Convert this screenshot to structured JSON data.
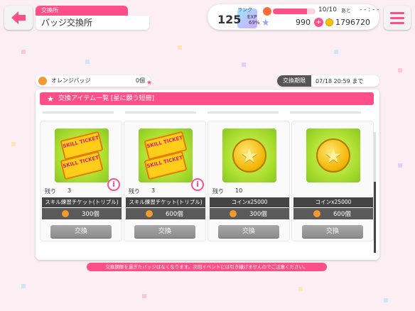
{
  "header": {
    "subtitle": "交換所",
    "title": "バッジ交換所"
  },
  "status": {
    "rank_label": "ランク",
    "rank": "125",
    "exp_label": "EXP",
    "exp_percent": "69%",
    "life": "10/10",
    "life_after": "あと",
    "life_time": "- - : - -",
    "life_fill": 0.8,
    "gems": "990",
    "coins": "1796720"
  },
  "badge": {
    "name": "オレンジバッジ",
    "count": "0個"
  },
  "deadline": {
    "label": "交換期限",
    "value": "07/18 20:59 まで"
  },
  "panel": {
    "title": "交換アイテム一覧 [星に願う短冊]",
    "items": [
      {
        "stock_label": "残り",
        "stock": "3",
        "name": "スキル練習チケット(トリプル)",
        "price": "300個",
        "button": "交換",
        "ticket_text": "SKILL TICKET"
      },
      {
        "stock_label": "残り",
        "stock": "3",
        "name": "スキル練習チケット(トリプル)",
        "price": "600個",
        "button": "交換",
        "ticket_text": "SKILL TICKET"
      },
      {
        "stock_label": "残り",
        "stock": "10",
        "name": "コインx25000",
        "price": "300個",
        "button": "交換"
      },
      {
        "stock_label": "",
        "stock": "",
        "name": "コインx25000",
        "price": "600個",
        "button": "交換"
      }
    ]
  },
  "notice": "交換期限を過ぎたバッジはなくなります。次回イベントには引き継げませんのでご注意ください。",
  "colors": {
    "accent": "#ff4f88",
    "background": "#fbeff4"
  }
}
